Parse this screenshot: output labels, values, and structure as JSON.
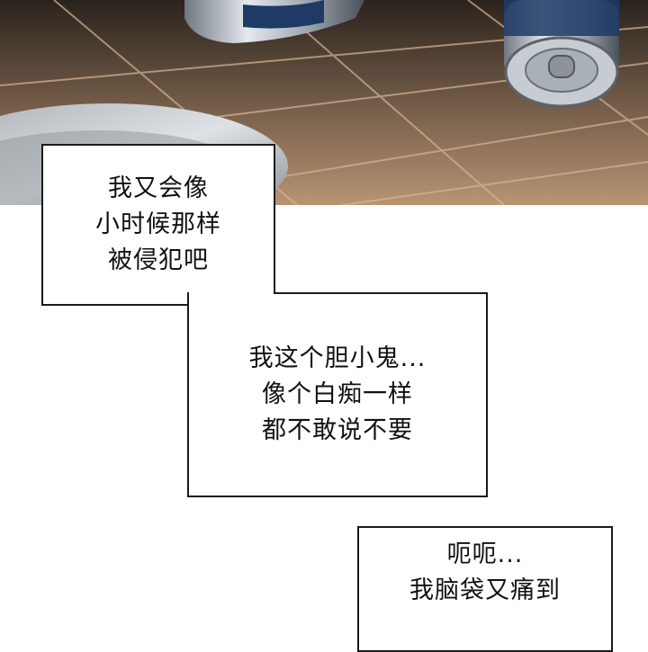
{
  "scene": {
    "description_colors": {
      "floor": "#8a6e55",
      "grout": "#c9a98a",
      "can": "#b9c0c8",
      "can_label": "#1f3a66"
    }
  },
  "bubbles": [
    {
      "lines": [
        "我又会像",
        "小时候那样",
        "被侵犯吧"
      ]
    },
    {
      "lines": [
        "我这个胆小鬼...",
        "像个白痴一样",
        "都不敢说不要"
      ]
    },
    {
      "lines": [
        "呃呃...",
        "我脑袋又痛到"
      ]
    }
  ]
}
